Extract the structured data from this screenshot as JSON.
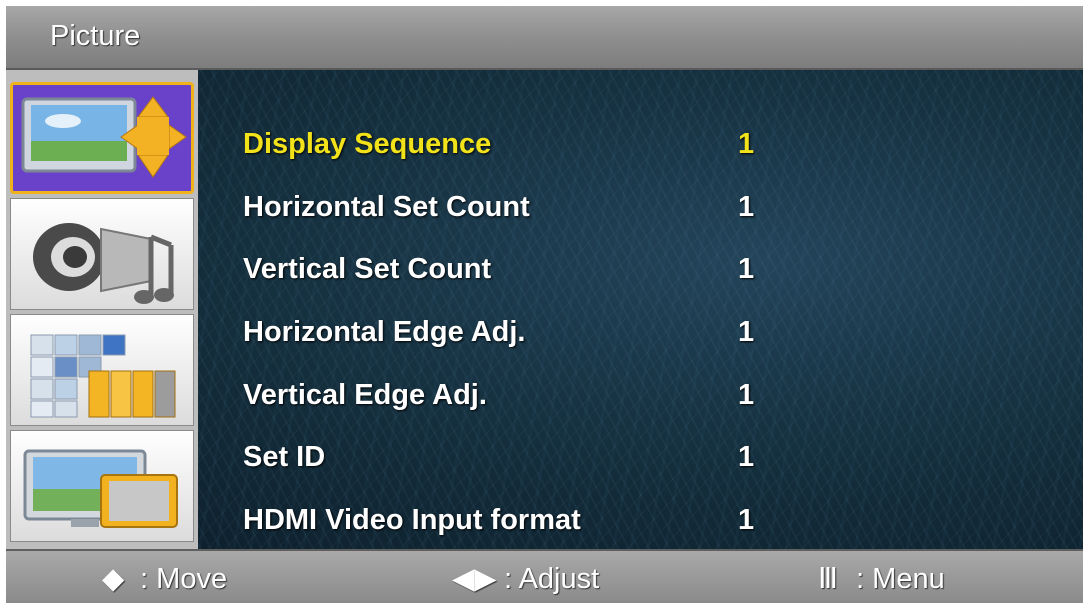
{
  "header": {
    "title": "Picture"
  },
  "sidebar": {
    "tabs": [
      {
        "name": "picture",
        "icon": "monitor-arrows-icon",
        "active": true
      },
      {
        "name": "sound",
        "icon": "speaker-note-icon",
        "active": false
      },
      {
        "name": "setup",
        "icon": "channel-grid-icon",
        "active": false
      },
      {
        "name": "input",
        "icon": "monitor-input-icon",
        "active": false
      }
    ]
  },
  "menu": {
    "items": [
      {
        "label": "Display Sequence",
        "value": "1",
        "selected": true
      },
      {
        "label": "Horizontal Set Count",
        "value": "1",
        "selected": false
      },
      {
        "label": "Vertical Set Count",
        "value": "1",
        "selected": false
      },
      {
        "label": "Horizontal Edge Adj.",
        "value": "1",
        "selected": false
      },
      {
        "label": "Vertical Edge Adj.",
        "value": "1",
        "selected": false
      },
      {
        "label": "Set ID",
        "value": "1",
        "selected": false
      },
      {
        "label": "HDMI Video Input format",
        "value": "1",
        "selected": false
      }
    ]
  },
  "footer": {
    "move": {
      "glyph": "◆",
      "text": ": Move"
    },
    "adjust": {
      "glyph": "◀▶",
      "text": ": Adjust"
    },
    "menu": {
      "glyph": "Ⅲ",
      "text": ": Menu"
    }
  },
  "colors": {
    "selected_text": "#f2e21a",
    "active_tab": "#6a41c9",
    "active_tab_border": "#f0b21a"
  }
}
